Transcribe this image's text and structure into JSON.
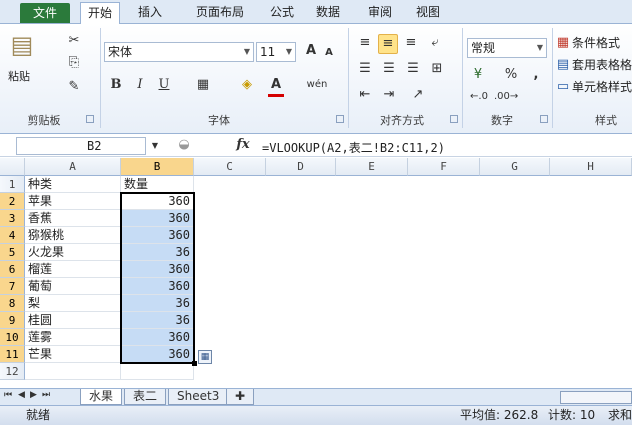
{
  "ribbon_tabs": [
    {
      "label": "文件",
      "type": "file"
    },
    {
      "label": "开始",
      "active": true
    },
    {
      "label": "插入"
    },
    {
      "label": "页面布局"
    },
    {
      "label": "公式"
    },
    {
      "label": "数据"
    },
    {
      "label": "审阅"
    },
    {
      "label": "视图"
    }
  ],
  "clipboard": {
    "paste_label": "粘贴",
    "group_label": "剪贴板"
  },
  "font": {
    "name": "宋体",
    "size": "11",
    "group_label": "字体",
    "bold": "B",
    "italic": "I",
    "underline": "U",
    "grow": "A",
    "shrink": "A",
    "color_a": "A",
    "phonetic": "wén"
  },
  "alignment": {
    "group_label": "对齐方式"
  },
  "number": {
    "format": "常规",
    "percent": "%",
    "comma": ",",
    "group_label": "数字"
  },
  "styles": {
    "cond_format": "条件格式",
    "table_format": "套用表格格",
    "cell_style": "单元格样式",
    "group_label": "样式"
  },
  "formula_bar": {
    "name_box": "B2",
    "fx": "fx",
    "formula": "=VLOOKUP(A2,表二!B2:C11,2)"
  },
  "columns": [
    "A",
    "B",
    "C",
    "D",
    "E",
    "F",
    "G",
    "H"
  ],
  "rows": [
    {
      "n": "1",
      "a": "种类",
      "b": "数量"
    },
    {
      "n": "2",
      "a": "苹果",
      "b": "360"
    },
    {
      "n": "3",
      "a": "香蕉",
      "b": "360"
    },
    {
      "n": "4",
      "a": "猕猴桃",
      "b": "360"
    },
    {
      "n": "5",
      "a": "火龙果",
      "b": "36"
    },
    {
      "n": "6",
      "a": "榴莲",
      "b": "360"
    },
    {
      "n": "7",
      "a": "葡萄",
      "b": "360"
    },
    {
      "n": "8",
      "a": "梨",
      "b": "36"
    },
    {
      "n": "9",
      "a": "桂圆",
      "b": "36"
    },
    {
      "n": "10",
      "a": "莲雾",
      "b": "360"
    },
    {
      "n": "11",
      "a": "芒果",
      "b": "360"
    },
    {
      "n": "12",
      "a": "",
      "b": ""
    }
  ],
  "sheets": [
    {
      "label": "水果",
      "active": true
    },
    {
      "label": "表二"
    },
    {
      "label": "Sheet3"
    }
  ],
  "status": {
    "ready": "就绪",
    "average": "平均值: 262.8",
    "count": "计数: 10",
    "sum": "求和"
  }
}
